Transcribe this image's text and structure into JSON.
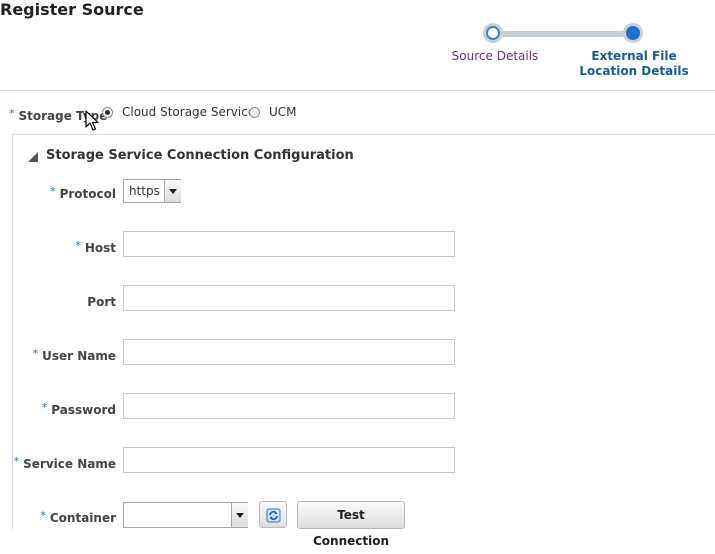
{
  "page": {
    "title": "Register Source"
  },
  "train": {
    "steps": [
      {
        "label": "Source Details",
        "state": "visited"
      },
      {
        "label": "External File Location Details",
        "state": "current"
      }
    ]
  },
  "storage_type": {
    "label": "Storage Type",
    "required": "*",
    "options": [
      {
        "label": "Cloud Storage Service",
        "selected": true
      },
      {
        "label": "UCM",
        "selected": false
      }
    ]
  },
  "section": {
    "title": "Storage Service Connection Configuration",
    "expanded": true
  },
  "form": {
    "protocol": {
      "label": "Protocol",
      "required": "*",
      "value": "https"
    },
    "host": {
      "label": "Host",
      "required": "*",
      "value": ""
    },
    "port": {
      "label": "Port",
      "required": "",
      "value": ""
    },
    "user_name": {
      "label": "User Name",
      "required": "*",
      "value": ""
    },
    "password": {
      "label": "Password",
      "required": "*",
      "value": ""
    },
    "service_name": {
      "label": "Service Name",
      "required": "*",
      "value": ""
    },
    "container": {
      "label": "Container",
      "required": "*",
      "value": ""
    }
  },
  "buttons": {
    "refresh_icon": "refresh-icon",
    "test_connection": "Test Connection"
  },
  "colors": {
    "required_star": "#2a68c7",
    "train_current": "#1f6fd0",
    "train_visited_label": "#6a2b82",
    "train_current_label": "#1a5aa0"
  }
}
